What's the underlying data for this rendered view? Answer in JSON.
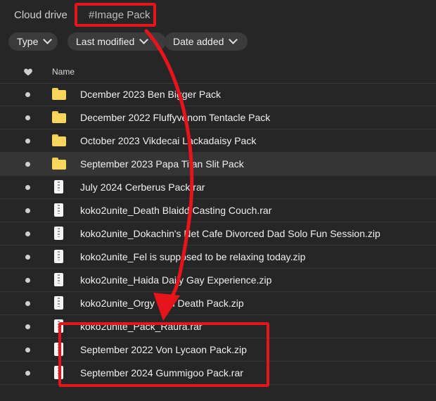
{
  "breadcrumb": {
    "root": "Cloud drive",
    "current": "#Image Pack"
  },
  "filters": [
    {
      "label": "Type"
    },
    {
      "label": "Last modified"
    },
    {
      "label": "Date added"
    }
  ],
  "table": {
    "favorite_icon": "heart-icon",
    "name_header": "Name",
    "rows": [
      {
        "name": "Dcember 2023 Ben Bigger Pack",
        "icon": "folder-icon"
      },
      {
        "name": "December 2022 Fluffyvenom Tentacle Pack",
        "icon": "folder-icon"
      },
      {
        "name": "October 2023 Vikdecai Lackadaisy Pack",
        "icon": "folder-icon"
      },
      {
        "name": "September 2023 Papa Titan Slit Pack",
        "icon": "folder-icon",
        "selected": true
      },
      {
        "name": "July 2024 Cerberus Pack.rar",
        "icon": "zip-file-icon"
      },
      {
        "name": "koko2unite_Death Blaidd Casting Couch.rar",
        "icon": "zip-file-icon"
      },
      {
        "name": "koko2unite_Dokachin's Net Cafe Divorced Dad Solo Fun Session.zip",
        "icon": "zip-file-icon"
      },
      {
        "name": "koko2unite_Fel is supposed to be relaxing today.zip",
        "icon": "zip-file-icon"
      },
      {
        "name": "koko2unite_Haida Daily Gay Experience.zip",
        "icon": "zip-file-icon"
      },
      {
        "name": "koko2unite_Orgy with Death Pack.zip",
        "icon": "zip-file-icon"
      },
      {
        "name": "koko2unite_Pack_Raura.rar",
        "icon": "zip-file-icon"
      },
      {
        "name": "September 2022 Von Lycaon Pack.zip",
        "icon": "zip-file-icon"
      },
      {
        "name": "September 2024 Gummigoo Pack.rar",
        "icon": "zip-file-icon"
      }
    ]
  },
  "annotation": {
    "color": "#e8141c"
  }
}
